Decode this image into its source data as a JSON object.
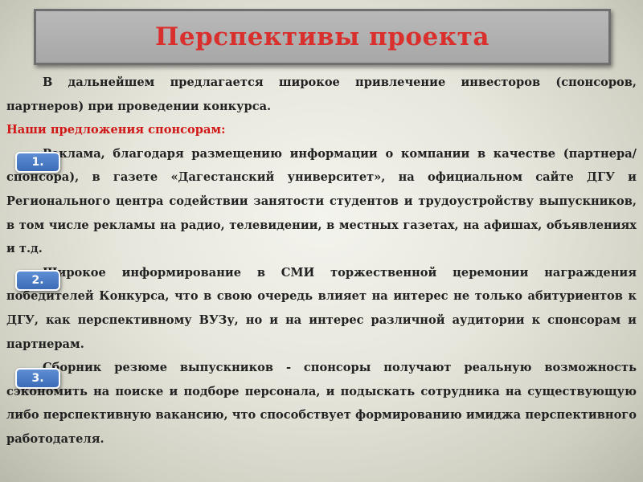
{
  "slide": {
    "title": "Перспективы проекта",
    "intro": "В дальнейшем предлагается широкое привлечение инвесторов (спонсоров, партнеров) при проведении конкурса.",
    "subheading": "Наши  предложения спонсорам:",
    "items": [
      {
        "marker": "1.",
        "text": "Реклама, благодаря размещению информации о компании в качестве (партнера/спонсора), в  газете «Дагестанский университет», на официальном сайте  ДГУ и Регионального центра содействии занятости студентов и трудоустройству выпускников, в том числе  рекламы на радио, телевидении, в местных газетах, на афишах, объявлениях и т.д."
      },
      {
        "marker": "2.",
        "text": "Широкое информирование в СМИ торжественной церемонии награждения победителей Конкурса, что в свою очередь влияет на интерес не только абитуриентов к  ДГУ, как перспективному ВУЗу,  но и на интерес различной аудитории к спонсорам и партнерам."
      },
      {
        "marker": "3.",
        "text": "Сборник резюме выпускников - спонсоры получают реальную возможность сэкономить на поиске и подборе персонала, и подыскать сотрудника на существующую либо перспективную вакансию, что способствует формированию имиджа перспективного работодателя."
      }
    ]
  },
  "colors": {
    "title_text": "#d9302e",
    "subheading_text": "#d01818",
    "marker_fill": "#4a7cc4",
    "body_text": "#222222"
  }
}
